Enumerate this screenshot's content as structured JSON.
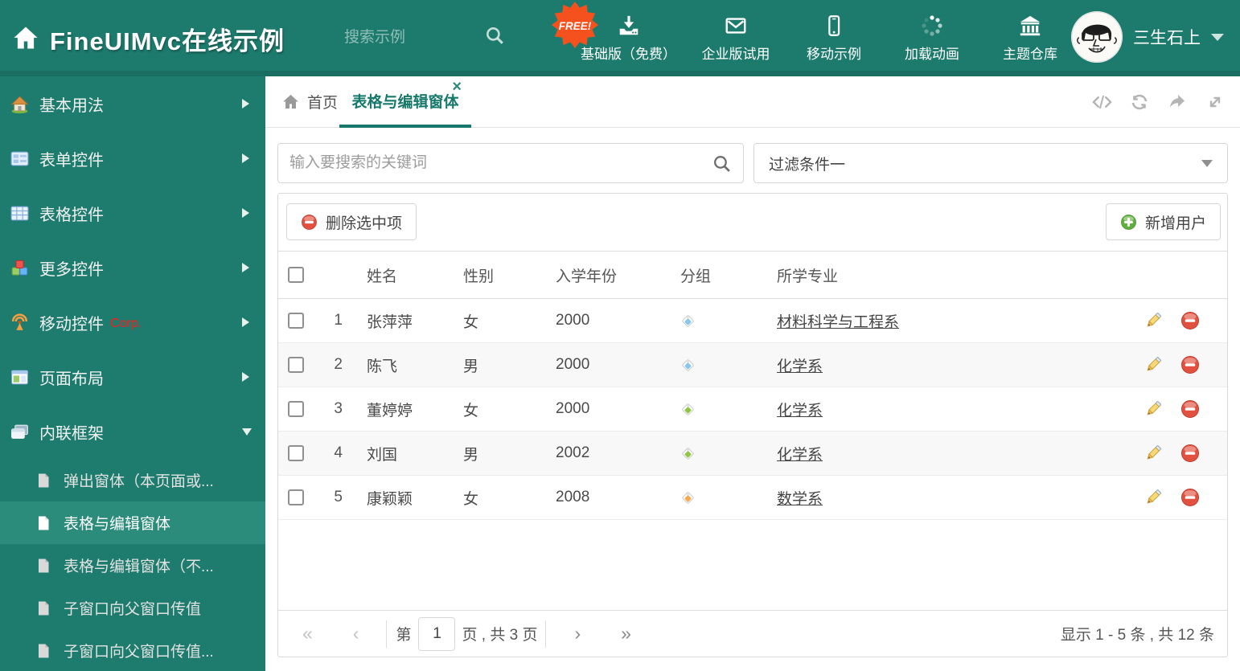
{
  "colors": {
    "header_teal": "#1d7b6d",
    "sidebar_teal": "#1e7c6e",
    "sidebar_selected": "#2b8c7c",
    "accent_teal": "#17796b",
    "free_badge_orange": "#f4511e",
    "corp_red": "#ff1a1a",
    "tag_blue": "#89c6ef",
    "tag_green": "#8fc645",
    "tag_orange": "#f7a94e"
  },
  "header": {
    "logo_title": "FineUIMvc在线示例",
    "search_placeholder": "搜索示例",
    "free_badge": "FREE!",
    "nav": [
      {
        "label": "基础版（免费）",
        "icon": "download-icon"
      },
      {
        "label": "企业版试用",
        "icon": "envelope-icon"
      },
      {
        "label": "移动示例",
        "icon": "mobile-icon"
      },
      {
        "label": "加载动画",
        "icon": "spinner-icon"
      },
      {
        "label": "主题仓库",
        "icon": "bank-icon"
      }
    ],
    "user_name": "三生石上"
  },
  "sidebar": {
    "items": [
      {
        "label": "基本用法",
        "icon": "house-icon"
      },
      {
        "label": "表单控件",
        "icon": "form-icon"
      },
      {
        "label": "表格控件",
        "icon": "table-icon"
      },
      {
        "label": "更多控件",
        "icon": "cubes-icon"
      },
      {
        "label": "移动控件",
        "icon": "antenna-icon",
        "badge": "Corp."
      },
      {
        "label": "页面布局",
        "icon": "layout-icon"
      },
      {
        "label": "内联框架",
        "icon": "frames-icon",
        "expanded": true
      }
    ],
    "subitems": [
      {
        "label": "弹出窗体（本页面或..."
      },
      {
        "label": "表格与编辑窗体",
        "selected": true
      },
      {
        "label": "表格与编辑窗体（不..."
      },
      {
        "label": "子窗口向父窗口传值"
      },
      {
        "label": "子窗口向父窗口传值..."
      }
    ]
  },
  "tabs": {
    "home_label": "首页",
    "active_label": "表格与编辑窗体",
    "close_glyph": "×"
  },
  "search_bar": {
    "placeholder": "输入要搜索的关键词",
    "filter_value": "过滤条件一"
  },
  "toolbar": {
    "delete_label": "删除选中项",
    "add_label": "新增用户"
  },
  "table": {
    "headers": {
      "name": "姓名",
      "gender": "性别",
      "year": "入学年份",
      "group": "分组",
      "major": "所学专业"
    },
    "rows": [
      {
        "num": "1",
        "name": "张萍萍",
        "gender": "女",
        "year": "2000",
        "tag_color": "#89c6ef",
        "major": "材料科学与工程系"
      },
      {
        "num": "2",
        "name": "陈飞",
        "gender": "男",
        "year": "2000",
        "tag_color": "#89c6ef",
        "major": "化学系"
      },
      {
        "num": "3",
        "name": "董婷婷",
        "gender": "女",
        "year": "2000",
        "tag_color": "#8fc645",
        "major": "化学系"
      },
      {
        "num": "4",
        "name": "刘国",
        "gender": "男",
        "year": "2002",
        "tag_color": "#8fc645",
        "major": "化学系"
      },
      {
        "num": "5",
        "name": "康颖颖",
        "gender": "女",
        "year": "2008",
        "tag_color": "#f7a94e",
        "major": "数学系"
      }
    ]
  },
  "pagination": {
    "first_glyph": "«",
    "prev_glyph": "‹",
    "next_glyph": "›",
    "last_glyph": "»",
    "page_prefix": "第",
    "page_value": "1",
    "page_suffix": "页 , 共 3 页",
    "summary": "显示 1 - 5 条 , 共 12 条"
  }
}
